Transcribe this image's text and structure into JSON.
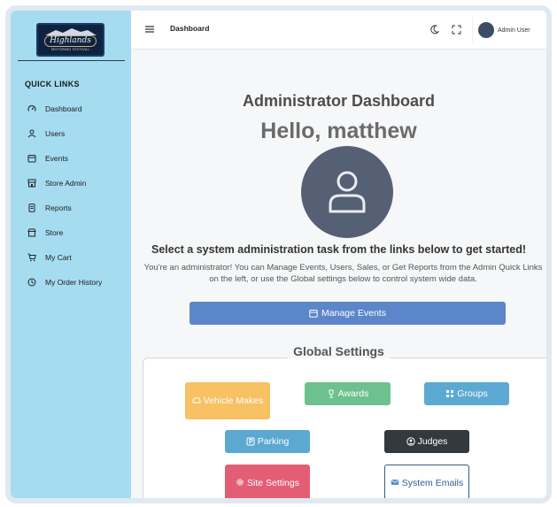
{
  "logo": {
    "script": "Highlands",
    "subtitle": "MOTORING FESTIVAL"
  },
  "sidebar": {
    "title": "QUICK LINKS",
    "items": [
      {
        "label": "Dashboard",
        "icon": "gauge-icon"
      },
      {
        "label": "Users",
        "icon": "users-icon"
      },
      {
        "label": "Events",
        "icon": "calendar-icon"
      },
      {
        "label": "Store Admin",
        "icon": "store-admin-icon"
      },
      {
        "label": "Reports",
        "icon": "report-icon"
      },
      {
        "label": "Store",
        "icon": "store-icon"
      },
      {
        "label": "My Cart",
        "icon": "cart-icon"
      },
      {
        "label": "My Order History",
        "icon": "history-icon"
      }
    ]
  },
  "header": {
    "title": "Dashboard",
    "user_name": "Admin User"
  },
  "main": {
    "title": "Administrator Dashboard",
    "greeting": "Hello, matthew",
    "select_task": "Select a system administration task from the links below to get started!",
    "description": "You're an administrator! You can Manage Events, Users, Sales, or Get Reports from the Admin Quick Links on the left, or use the Global settings below to control system wide data.",
    "manage_events": "Manage Events"
  },
  "global_settings": {
    "title": "Global Settings",
    "vehicle_makes": "Vehicle Makes",
    "awards": "Awards",
    "groups": "Groups",
    "parking": "Parking",
    "judges": "Judges",
    "site_settings": "Site Settings",
    "system_emails": "System Emails"
  },
  "colors": {
    "sidebar": "#a6dcf0",
    "manage": "#5b86c9",
    "vehicle": "#f7c164",
    "awards": "#6cc18f",
    "groups": "#5ca9d3",
    "judges": "#33393f",
    "site": "#e35e74"
  }
}
